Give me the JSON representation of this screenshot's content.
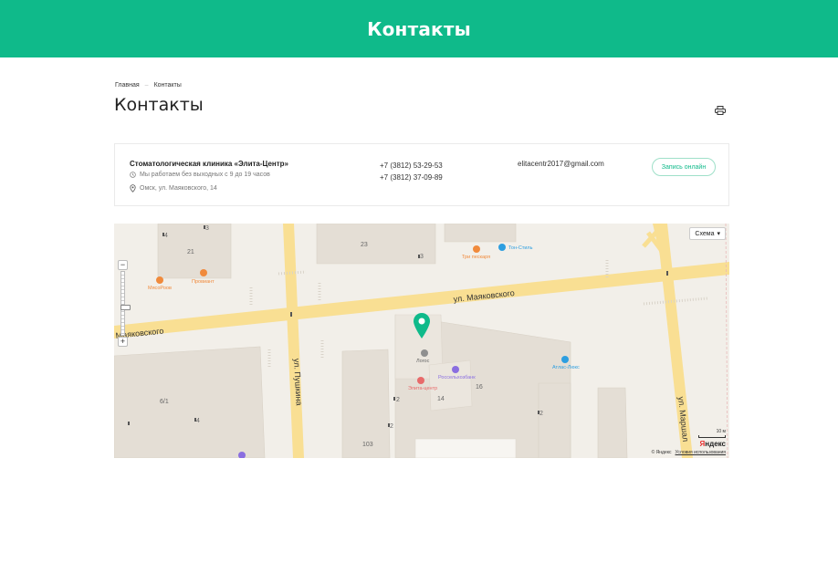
{
  "banner": {
    "title": "Контакты"
  },
  "breadcrumb": {
    "home": "Главная",
    "current": "Контакты"
  },
  "page": {
    "title": "Контакты"
  },
  "contact": {
    "clinic_name": "Стоматологическая клиника «Элита-Центр»",
    "hours": "Мы работаем без выходных с 9 до 19 часов",
    "address": "Омск, ул. Маяковского, 14",
    "phones": [
      "+7 (3812) 53-29-53",
      "+7 (3812) 37-09-89"
    ],
    "email": "elitacentr2017@gmail.com",
    "book_button": "Запись онлайн"
  },
  "map": {
    "scheme_button": "Схема",
    "streets": {
      "mayakovskogo_right": "ул. Маяковского",
      "mayakovskogo_left": "Маяковского",
      "pushkina": "ул. Пушкина",
      "marshala": "ул. Маршал"
    },
    "buildings": [
      "21",
      "23",
      "6/1",
      "14",
      "16",
      "103",
      "4",
      "3",
      "2",
      "2",
      "2",
      "4",
      "3"
    ],
    "pois": {
      "myasoroob": "МясоРоов",
      "proviant": "Провиант",
      "tri_peskarya": "Три пескаря",
      "ton_stil": "Тон-Стиль",
      "logos": "Логос",
      "rosselkhozbank": "Россельхозбанк",
      "elita_centr": "Элита-центр",
      "atlas_lyuks": "Атлас-Люкс"
    },
    "scale": "10 м",
    "logo": "Яндекс",
    "copyright": "© Яндекс",
    "terms": "Условия использования",
    "colors": {
      "road_yellow": "#f9df93",
      "building": "#e4ded5",
      "pin": "#0fba8a",
      "ground": "#f2efe9"
    }
  }
}
